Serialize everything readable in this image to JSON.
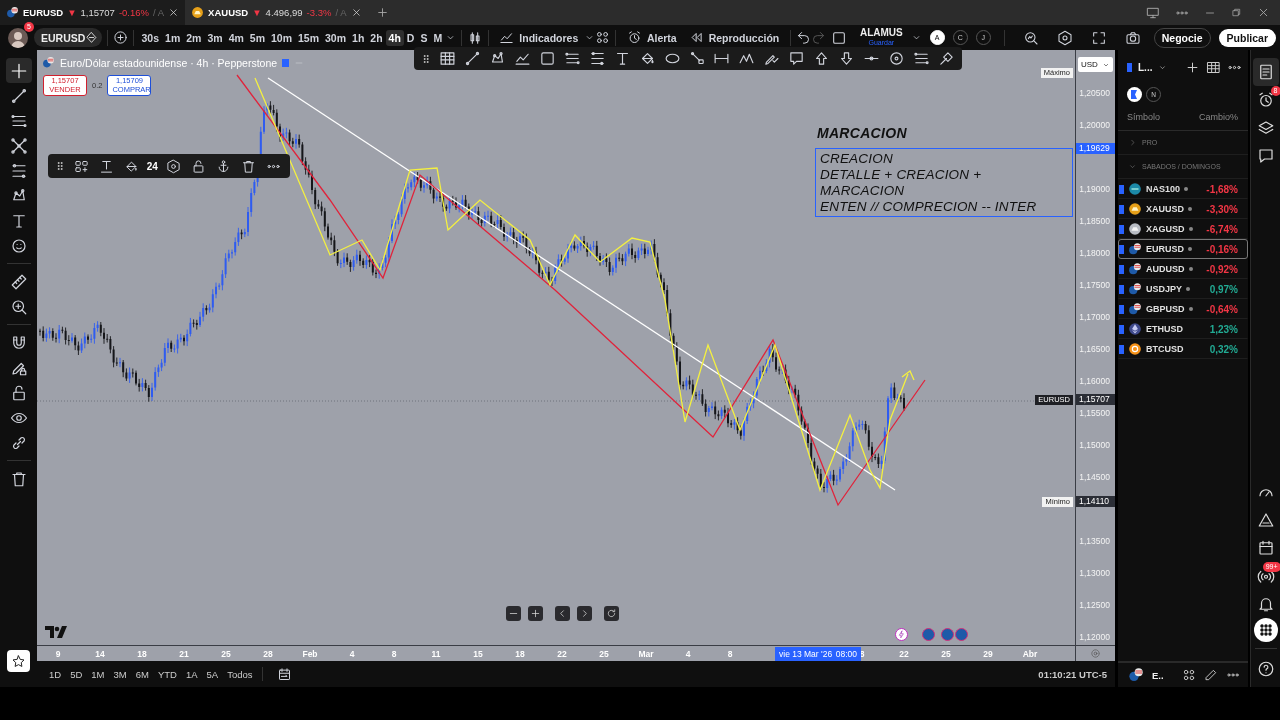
{
  "browser_tabs": [
    {
      "symbol": "EURUSD",
      "arrow": "▼",
      "price": "1,15707",
      "change": "-0.16%",
      "suffix": "/ A",
      "selected": true,
      "kind": "forex"
    },
    {
      "symbol": "XAUUSD",
      "arrow": "▼",
      "price": "4.496,99",
      "change": "-3.3%",
      "suffix": "/ A",
      "selected": false,
      "kind": "gold"
    }
  ],
  "toolbar": {
    "notifications": "5",
    "symbol": "EURUSD",
    "intervals": [
      {
        "label": "30s",
        "selected": false
      },
      {
        "label": "1m",
        "selected": false
      },
      {
        "label": "2m",
        "selected": false
      },
      {
        "label": "3m",
        "selected": false
      },
      {
        "label": "4m",
        "selected": false
      },
      {
        "label": "5m",
        "selected": false
      },
      {
        "label": "10m",
        "selected": false
      },
      {
        "label": "15m",
        "selected": false
      },
      {
        "label": "30m",
        "selected": false
      },
      {
        "label": "1h",
        "selected": false
      },
      {
        "label": "2h",
        "selected": false
      },
      {
        "label": "4h",
        "selected": true
      },
      {
        "label": "D",
        "selected": false
      },
      {
        "label": "S",
        "selected": false
      },
      {
        "label": "M",
        "selected": false
      }
    ],
    "indicators": "Indicadores",
    "alert": "Alerta",
    "replay": "Reproducción",
    "layout_name": "ALAMUS",
    "layout_status": "Guardar",
    "users": [
      {
        "label": "A",
        "selected": true
      },
      {
        "label": "C",
        "selected": false
      },
      {
        "label": "J",
        "selected": false
      }
    ],
    "trade": "Negocie",
    "publish": "Publicar"
  },
  "left_toolbar": [
    {
      "selected": true
    },
    {
      "selected": false
    },
    {
      "selected": false
    },
    {
      "selected": false
    },
    {
      "selected": false
    },
    {
      "selected": false
    },
    {
      "selected": false
    },
    {
      "selected": false
    },
    {
      "selected": false
    },
    {
      "selected": false
    },
    {
      "selected": false
    },
    {
      "selected": false
    },
    {
      "selected": false
    },
    {
      "selected": false
    },
    {
      "selected": false
    },
    {
      "selected": false
    }
  ],
  "chart": {
    "legend": {
      "title": "Euro/Dólar estadounidense · 4h · Pepperstone",
      "sell_price": "1,15707",
      "sell_label": "VENDER",
      "spread": "0.2",
      "buy_price": "1,15709",
      "buy_label": "COMPRAR"
    },
    "text_toolbar": {
      "font_size": "24"
    },
    "annotations": [
      {
        "kind": "label",
        "lines": [
          "MARCACION"
        ]
      },
      {
        "kind": "box",
        "lines": [
          "CREACION",
          "DETALLE + CREACION +",
          "MARCACION",
          "ENTEN // COMPRECION -- INTER"
        ]
      }
    ]
  },
  "price_axis": {
    "currency": "USD",
    "ticks": [
      "1,20500",
      "1,20000",
      "1,19000",
      "1,18500",
      "1,18000",
      "1,17500",
      "1,17000",
      "1,16500",
      "1,16000",
      "1,15500",
      "1,15000",
      "1,14500",
      "1,13500",
      "1,13000",
      "1,12500",
      "1,12000"
    ],
    "markers": [
      {
        "kind": "high",
        "label": "Máximo"
      },
      {
        "kind": "drawing",
        "price": "1,19629"
      },
      {
        "kind": "last",
        "label": "EURUSD",
        "price": "1,15707"
      },
      {
        "kind": "low",
        "label": "Mínimo",
        "price": "1,14110"
      }
    ]
  },
  "time_axis": [
    {
      "kind": "tick",
      "text": "9"
    },
    {
      "kind": "tick",
      "text": "14"
    },
    {
      "kind": "tick",
      "text": "18"
    },
    {
      "kind": "tick",
      "text": "21"
    },
    {
      "kind": "tick",
      "text": "25"
    },
    {
      "kind": "tick",
      "text": "28"
    },
    {
      "kind": "tick",
      "text": "Feb"
    },
    {
      "kind": "tick",
      "text": "4"
    },
    {
      "kind": "tick",
      "text": "8"
    },
    {
      "kind": "tick",
      "text": "11"
    },
    {
      "kind": "tick",
      "text": "15"
    },
    {
      "kind": "tick",
      "text": "18"
    },
    {
      "kind": "tick",
      "text": "22"
    },
    {
      "kind": "tick",
      "text": "25"
    },
    {
      "kind": "tick",
      "text": "Mar"
    },
    {
      "kind": "tick",
      "text": "4"
    },
    {
      "kind": "tick",
      "text": "8"
    },
    {
      "kind": "cursor",
      "date": "vie 13 Mar '26",
      "time": "08:00"
    },
    {
      "kind": "tick",
      "text": "8"
    },
    {
      "kind": "tick",
      "text": "22"
    },
    {
      "kind": "tick",
      "text": "25"
    },
    {
      "kind": "tick",
      "text": "29"
    },
    {
      "kind": "tick",
      "text": "Abr"
    }
  ],
  "ranges": [
    "1D",
    "5D",
    "1M",
    "3M",
    "6M",
    "YTD",
    "1A",
    "5A",
    "Todos"
  ],
  "clock": "01:10:21 UTC-5",
  "watchlist": {
    "name": "L...",
    "filter_label": "N",
    "columns": [
      "Símbolo",
      "Cambio%"
    ],
    "sections": [
      {
        "title": "PRO",
        "expanded": false
      },
      {
        "title": "SABADOS / DOMINGOS",
        "expanded": true,
        "rows": [
          {
            "symbol": "NAS100",
            "change": "-1,68%",
            "color": "#f23645",
            "dot": true,
            "selected": false,
            "kind": "index"
          },
          {
            "symbol": "XAUUSD",
            "change": "-3,30%",
            "color": "#f23645",
            "dot": true,
            "selected": false,
            "kind": "gold"
          },
          {
            "symbol": "XAGUSD",
            "change": "-6,74%",
            "color": "#f23645",
            "dot": true,
            "selected": false,
            "kind": "silver"
          },
          {
            "symbol": "EURUSD",
            "change": "-0,16%",
            "color": "#f23645",
            "dot": true,
            "selected": true,
            "kind": "forex"
          },
          {
            "symbol": "AUDUSD",
            "change": "-0,92%",
            "color": "#f23645",
            "dot": true,
            "selected": false,
            "kind": "forex"
          },
          {
            "symbol": "USDJPY",
            "change": "0,97%",
            "color": "#22ab94",
            "dot": true,
            "selected": false,
            "kind": "forex"
          },
          {
            "symbol": "GBPUSD",
            "change": "-0,64%",
            "color": "#f23645",
            "dot": true,
            "selected": false,
            "kind": "forex"
          },
          {
            "symbol": "ETHUSD",
            "change": "1,23%",
            "color": "#22ab94",
            "dot": false,
            "selected": false,
            "kind": "eth"
          },
          {
            "symbol": "BTCUSD",
            "change": "0,32%",
            "color": "#22ab94",
            "dot": false,
            "selected": false,
            "kind": "btc"
          }
        ]
      }
    ],
    "footer_symbol": "E.."
  },
  "side_badges": {
    "alerts": "8",
    "notifications": "99+"
  }
}
